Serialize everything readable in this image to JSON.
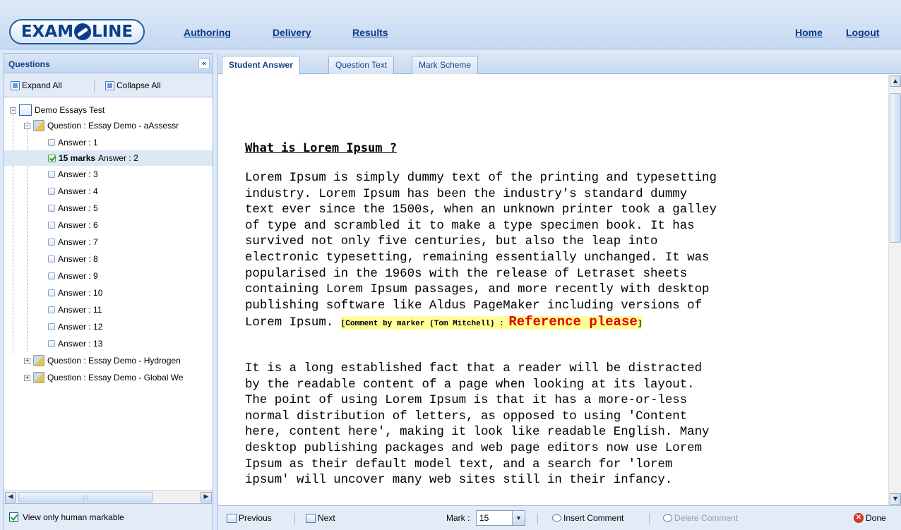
{
  "header": {
    "logo_text": "EXAMONLINE",
    "logo_left": "EXAM",
    "logo_right": "LINE",
    "nav": [
      {
        "label": "Authoring"
      },
      {
        "label": "Delivery"
      },
      {
        "label": "Results"
      }
    ],
    "right_nav": [
      {
        "label": "Home"
      },
      {
        "label": "Logout"
      }
    ]
  },
  "left_panel": {
    "title": "Questions",
    "expand_all": "Expand All",
    "collapse_all": "Collapse All",
    "tree": {
      "root": "Demo Essays Test",
      "question1": "Question : Essay Demo - aAssessr",
      "answers": [
        "Answer : 1",
        "Answer : 2",
        "Answer : 3",
        "Answer : 4",
        "Answer : 5",
        "Answer : 6",
        "Answer : 7",
        "Answer : 8",
        "Answer : 9",
        "Answer : 10",
        "Answer : 11",
        "Answer : 12",
        "Answer : 13"
      ],
      "selected_marks": "15 marks",
      "question2": "Question : Essay Demo - Hydrogen",
      "question3": "Question : Essay Demo - Global We"
    },
    "footer_checkbox": "View only human markable"
  },
  "tabs": [
    {
      "label": "Student Answer",
      "active": true
    },
    {
      "label": "Question Text",
      "active": false
    },
    {
      "label": "Mark Scheme",
      "active": false
    }
  ],
  "document": {
    "title": "What is Lorem Ipsum ?",
    "para1": "Lorem Ipsum is simply dummy text of the printing and typesetting\nindustry. Lorem Ipsum has been the industry's standard dummy\ntext ever since the 1500s, when an unknown printer took a galley\nof type and scrambled it to make a type specimen book. It has\nsurvived not only five centuries, but also the leap into\nelectronic typesetting, remaining essentially unchanged. It was\npopularised in the 1960s with the release of Letraset sheets\ncontaining Lorem Ipsum passages, and more recently with desktop\npublishing software like Aldus PageMaker including versions of\nLorem Ipsum.",
    "comment_prefix": "[Comment by marker (Tom Mitchell) : ",
    "comment_text": "Reference please",
    "comment_suffix": "]",
    "para2": "It is a long established fact that a reader will be distracted\nby the readable content of a page when looking at its layout.\nThe point of using Lorem Ipsum is that it has a more-or-less\nnormal distribution of letters, as opposed to using 'Content\nhere, content here', making it look like readable English. Many\ndesktop publishing packages and web page editors now use Lorem\nIpsum as their default model text, and a search for 'lorem\nipsum' will uncover many web sites still in their infancy."
  },
  "footer": {
    "previous": "Previous",
    "next": "Next",
    "mark_label": "Mark :",
    "mark_value": "15",
    "insert_comment": "Insert Comment",
    "delete_comment": "Delete Comment",
    "done": "Done"
  },
  "colors": {
    "header_link": "#0b3a8a",
    "comment_highlight": "#ffff99",
    "comment_text": "#e30000",
    "panel_border": "#99bbe8"
  }
}
